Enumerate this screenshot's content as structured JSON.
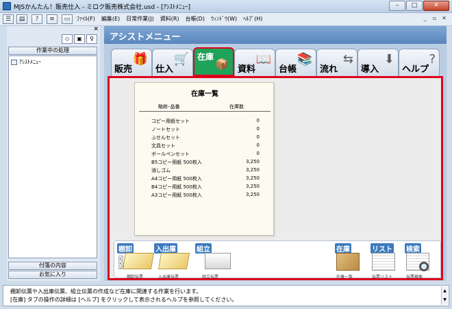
{
  "window": {
    "title": "MJSかんたん！販売仕入 - ミロク販売株式会社.usd - [ｱｼｽﾄﾒﾆｭｰ]",
    "controls": {
      "minimize": "–",
      "maximize": "□",
      "close": "✕"
    }
  },
  "toolbar": {
    "icons": [
      "app-menu-icon",
      "document-icon",
      "help-icon",
      "list-icon",
      "window-icon"
    ]
  },
  "menu": {
    "items": [
      "ﾌｧｲﾙ(F)",
      "編集(E)",
      "日常作業(J)",
      "資料(R)",
      "台帳(D)",
      "ｳｨﾝﾄﾞｳ(W)",
      "ﾍﾙﾌﾟ(H)"
    ],
    "mdi": {
      "minimize": "_",
      "restore": "▫",
      "close": "✕"
    }
  },
  "sidebar": {
    "close": "✕",
    "header": "作業中の処理",
    "tree_item": "ｱｼｽﾄﾒﾆｭｰ",
    "buttons": {
      "sticky": "付箋の内容",
      "favorites": "お気に入り"
    }
  },
  "main": {
    "title": "アシストメニュー",
    "tabs": [
      {
        "label": "販売",
        "icon": "🎁"
      },
      {
        "label": "仕入",
        "icon": "🛒"
      },
      {
        "label": "在庫",
        "icon": "📦"
      },
      {
        "label": "資料",
        "icon": "📖"
      },
      {
        "label": "台帳",
        "icon": "📚"
      },
      {
        "label": "流れ",
        "icon": "⇆"
      },
      {
        "label": "導入",
        "icon": "⬇"
      },
      {
        "label": "ヘルプ",
        "icon": "?"
      }
    ],
    "active_tab": "在庫"
  },
  "inventory": {
    "title": "在庫一覧",
    "col_name": "略称･品番",
    "col_qty": "在庫数",
    "rows": [
      {
        "name": "コピー用紙セット",
        "qty": "0"
      },
      {
        "name": "ノートセット",
        "qty": "0"
      },
      {
        "name": "ふせんセット",
        "qty": "0"
      },
      {
        "name": "文具セット",
        "qty": "0"
      },
      {
        "name": "ボールペンセット",
        "qty": "0"
      },
      {
        "name": "B5コピー用紙 500枚入",
        "qty": "3,250"
      },
      {
        "name": "消しゴム",
        "qty": "3,250"
      },
      {
        "name": "A4コピー用紙 500枚入",
        "qty": "3,250"
      },
      {
        "name": "B4コピー用紙 500枚入",
        "qty": "3,250"
      },
      {
        "name": "A3コピー用紙 500枚入",
        "qty": "3,250"
      }
    ]
  },
  "launcher": {
    "left": [
      {
        "title": "棚卸",
        "sub": "棚卸伝票"
      },
      {
        "title": "入出庫",
        "sub": "入出庫伝票"
      },
      {
        "title": "組立",
        "sub": "組立伝票"
      }
    ],
    "right": [
      {
        "title": "在庫",
        "sub": "在庫一覧"
      },
      {
        "title": "リスト",
        "sub": "伝票リスト"
      },
      {
        "title": "検索",
        "sub": "伝票検索"
      }
    ]
  },
  "status": {
    "line1": "棚卸伝票や入出庫伝票、組立伝票の作成など在庫に関連する作業を行います。",
    "line2": "[在庫] タブの操作の詳細は [ヘルプ] をクリックして表示されるヘルプを参照してください。"
  }
}
